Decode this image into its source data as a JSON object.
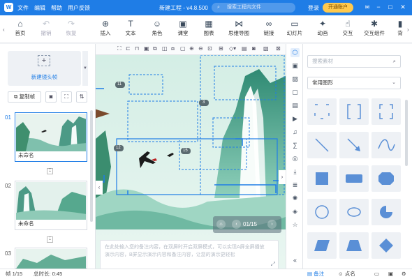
{
  "titlebar": {
    "logo": "W",
    "menus": [
      "文件",
      "编辑",
      "帮助",
      "用户反馈"
    ],
    "title": "新建工程 - v4.8.500",
    "search_placeholder": "搜索工程内文件",
    "login": "登录",
    "vip": "开通账户",
    "controls": [
      "−",
      "□",
      "✕"
    ]
  },
  "toolbar": {
    "items": [
      {
        "label": "首页",
        "icon": "⌂"
      },
      {
        "label": "撤销",
        "icon": "↶"
      },
      {
        "label": "恢复",
        "icon": "↷"
      },
      {
        "label": "插入",
        "icon": "⊕"
      },
      {
        "label": "文本",
        "icon": "T"
      },
      {
        "label": "角色",
        "icon": "☺"
      },
      {
        "label": "课堂",
        "icon": "▣"
      },
      {
        "label": "图表",
        "icon": "▦"
      },
      {
        "label": "思维导图",
        "icon": "⋈"
      },
      {
        "label": "链接",
        "icon": "∞"
      },
      {
        "label": "幻灯片",
        "icon": "▭"
      },
      {
        "label": "动画",
        "icon": "✦"
      },
      {
        "label": "交互",
        "icon": "☝"
      },
      {
        "label": "交互组件",
        "icon": "✱"
      },
      {
        "label": "背",
        "icon": "▮"
      }
    ]
  },
  "left": {
    "new_camera": "新建镜头帧",
    "copy_frame": "复制帧",
    "slides": [
      {
        "num": "01",
        "name": "未命名"
      },
      {
        "num": "02",
        "name": "未命名"
      },
      {
        "num": "03",
        "name": ""
      }
    ]
  },
  "canvas": {
    "badges": [
      "11",
      "3",
      "12",
      "15"
    ],
    "notes_placeholder": "在此处输入您的备注内容，在双屏时开启双屏模式，可以实现A屏全屏播放演示内容，B屏显示演示内容和备注内容，让您的演示更轻松",
    "page_counter": "01/15"
  },
  "rpanel": {
    "search_placeholder": "搜索素材",
    "category": "常用图形"
  },
  "statusbar": {
    "page": "帧 1/15",
    "duration": "总时长: 0:45",
    "notes": "备注",
    "comments": "点名"
  },
  "colors": {
    "accent": "#1f7de6",
    "shape_fill": "#5a8fd6"
  }
}
